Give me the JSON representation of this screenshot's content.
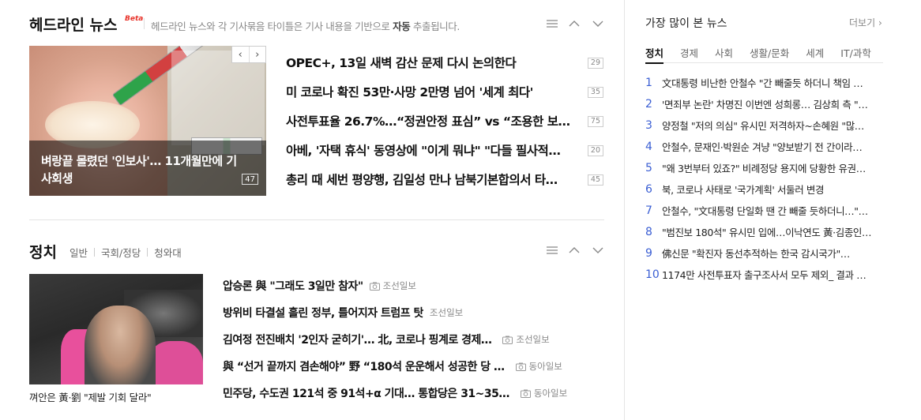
{
  "headline": {
    "title": "헤드라인 뉴스",
    "beta": "Beta",
    "desc_pre": "헤드라인 뉴스와 각 기사묶음 타이틀은 기사 내용을 기반으로 ",
    "desc_bold": "자동",
    "desc_post": " 추출됩니다.",
    "photo_caption": "벼랑끝 몰렸던 '인보사'… 11개월만에 기사회생",
    "photo_count": "47",
    "items": [
      {
        "title": "OPEC+, 13일 새벽 감산 문제 다시 논의한다",
        "count": "29"
      },
      {
        "title": "미 코로나 확진 53만·사망 2만명 넘어 '세계 최다'",
        "count": "35"
      },
      {
        "title": "사전투표율 26.7%…“정권안정 표심” vs “조용한 보수…",
        "count": "75"
      },
      {
        "title": "아베, '자택 휴식' 동영상에 \"이게 뭐냐\" \"다들 필사적…",
        "count": "20"
      },
      {
        "title": "총리 때 세번 평양행, 김일성 만나 남북기본합의서 타…",
        "count": "45"
      }
    ]
  },
  "politics": {
    "title": "정치",
    "tabs": [
      "일반",
      "국회/정당",
      "청와대"
    ],
    "photo_caption": "껴안은 黃·劉 \"제발 기회 달라\"",
    "items": [
      {
        "title": "압승론 與 \"그래도 3일만 참자\"",
        "source": "조선일보",
        "photo_icon": true
      },
      {
        "title": "방위비 타결설 흘린 정부, 틀어지자 트럼프 탓",
        "source": "조선일보",
        "photo_icon": false
      },
      {
        "title": "김여정 전진배치 '2인자 굳히기'… 北, 코로나 핑계로 경제…",
        "source": "조선일보",
        "photo_icon": true
      },
      {
        "title": "與 “선거 끝까지 겸손해야” 野 “180석 운운해서 성공한 당 …",
        "source": "동아일보",
        "photo_icon": true
      },
      {
        "title": "민주당, 수도권 121석 중 91석+α 기대… 통합당은 31~35…",
        "source": "동아일보",
        "photo_icon": true
      }
    ]
  },
  "most_viewed": {
    "title": "가장 많이 본 뉴스",
    "more": "더보기",
    "tabs": [
      "정치",
      "경제",
      "사회",
      "생활/문화",
      "세계",
      "IT/과학"
    ],
    "active_tab": "정치",
    "items": [
      {
        "rank": "1",
        "title": "文대통령 비난한 안철수 \"간 빼줄듯 하더니 책임 …"
      },
      {
        "rank": "2",
        "title": "'면죄부 논란' 차명진 이번엔 성희롱… 김상희 측 \"…"
      },
      {
        "rank": "3",
        "title": "양정철 \"저의 의심\" 유시민 저격하자~손혜원 \"많…"
      },
      {
        "rank": "4",
        "title": "안철수, 문재인·박원순 겨냥 \"양보받기 전 간이라…"
      },
      {
        "rank": "5",
        "title": "\"왜 3번부터 있죠?\" 비례정당 용지에 당황한 유권…"
      },
      {
        "rank": "6",
        "title": "북, 코로나 사태로 '국가계획' 서둘러 변경"
      },
      {
        "rank": "7",
        "title": "안철수, \"文대통령 단일화 땐 간 빼줄 듯하더니…\"…"
      },
      {
        "rank": "8",
        "title": "\"범진보 180석\" 유시민 입에…이낙연도 黃·김종인도 …"
      },
      {
        "rank": "9",
        "title": "佛신문 \"확진자 동선추적하는 한국 감시국가\"…"
      },
      {
        "rank": "10",
        "title": "1174만 사전투표자 출구조사서 모두 제외_ 결과 …"
      }
    ]
  },
  "colors": {
    "rank_blue": "#3a5ed3",
    "beta_red": "#e8332a"
  }
}
